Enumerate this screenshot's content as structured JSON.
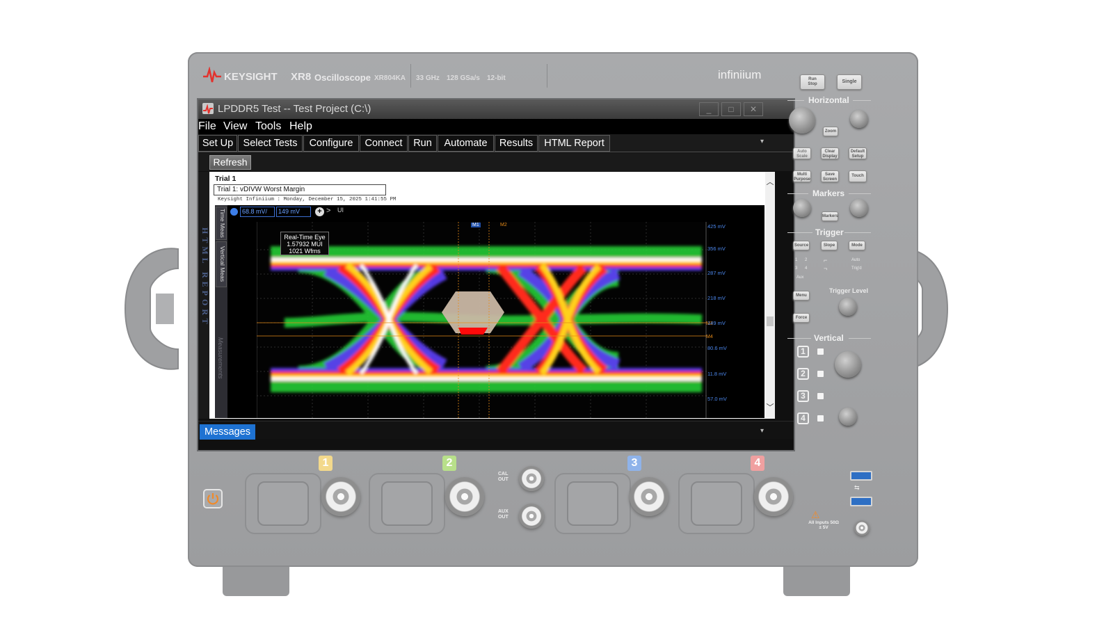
{
  "instrument": {
    "brand": "KEYSIGHT",
    "model": "XR8",
    "type": "Oscilloscope",
    "model_number": "XR804KA",
    "specs": [
      "33 GHz",
      "128 GSa/s",
      "12-bit"
    ],
    "family": "infiniium"
  },
  "window": {
    "title": "LPDDR5 Test -- Test Project  (C:\\)",
    "controls": [
      "_",
      "□",
      "✕"
    ]
  },
  "menu": [
    "File",
    "View",
    "Tools",
    "Help"
  ],
  "tabs": [
    "Set Up",
    "Select Tests",
    "Configure",
    "Connect",
    "Run",
    "Automate",
    "Results",
    "HTML Report"
  ],
  "refresh_label": "Refresh",
  "side_label": "HTML REPORT",
  "report": {
    "trial": "Trial 1",
    "trial_box": "Trial 1: vDIVW Worst Margin",
    "stamp": "Keysight Infiniium : Monday, December 15, 2025 1:41:55 PM"
  },
  "capture": {
    "side_tabs": [
      "Time Meas",
      "Vertical Meas"
    ],
    "chip_1": "68.8 mV/",
    "chip_2": "149 mV",
    "tooltip": [
      "Real-Time Eye",
      "1.57932 MUI",
      "1021 Wfms"
    ],
    "markers": [
      "M1",
      "M2",
      "M3",
      "M4"
    ],
    "y_labels": [
      "425 mV",
      "356 mV",
      "287 mV",
      "218 mV",
      "149 mV",
      "80.6 mV",
      "11.8 mV",
      "57.0 mV"
    ],
    "measurements_label": "Measurements"
  },
  "messages_label": "Messages",
  "panel": {
    "run_stop": "Run\nStop",
    "single": "Single",
    "horizontal": "Horizontal",
    "zoom": "Zoom",
    "auto_scale": "Auto\nScale",
    "clear_display": "Clear\nDisplay",
    "default_setup": "Default\nSetup",
    "multi_purpose": "Multi\nPurpose",
    "save_screen": "Save\nScreen",
    "touch": "Touch",
    "markers": "Markers",
    "markers_btn": "Markers",
    "trigger": "Trigger",
    "source": "Source",
    "slope": "Slope",
    "mode": "Mode",
    "trig_src_1": "1",
    "trig_src_2": "2",
    "trig_src_3": "3",
    "trig_src_4": "4",
    "aux": "Aux",
    "auto": "Auto",
    "trigd": "Trig'd",
    "trigger_level": "Trigger Level",
    "menu": "Menu",
    "force": "Force",
    "vertical": "Vertical",
    "ch1": "1",
    "ch2": "2",
    "ch3": "3",
    "ch4": "4"
  },
  "front": {
    "channels": [
      "1",
      "2",
      "3",
      "4"
    ],
    "cal_out": "CAL\nOUT",
    "aux_out": "AUX\nOUT",
    "warning_line1": "All Inputs 50Ω",
    "warning_line2": "± 5V"
  },
  "colors": {
    "ch1": "#f3d98c",
    "ch2": "#b8e08a",
    "ch3": "#8fb3ea",
    "ch4": "#f0a0a0",
    "accent": "#1e72d2",
    "brand_red": "#e3322d"
  }
}
